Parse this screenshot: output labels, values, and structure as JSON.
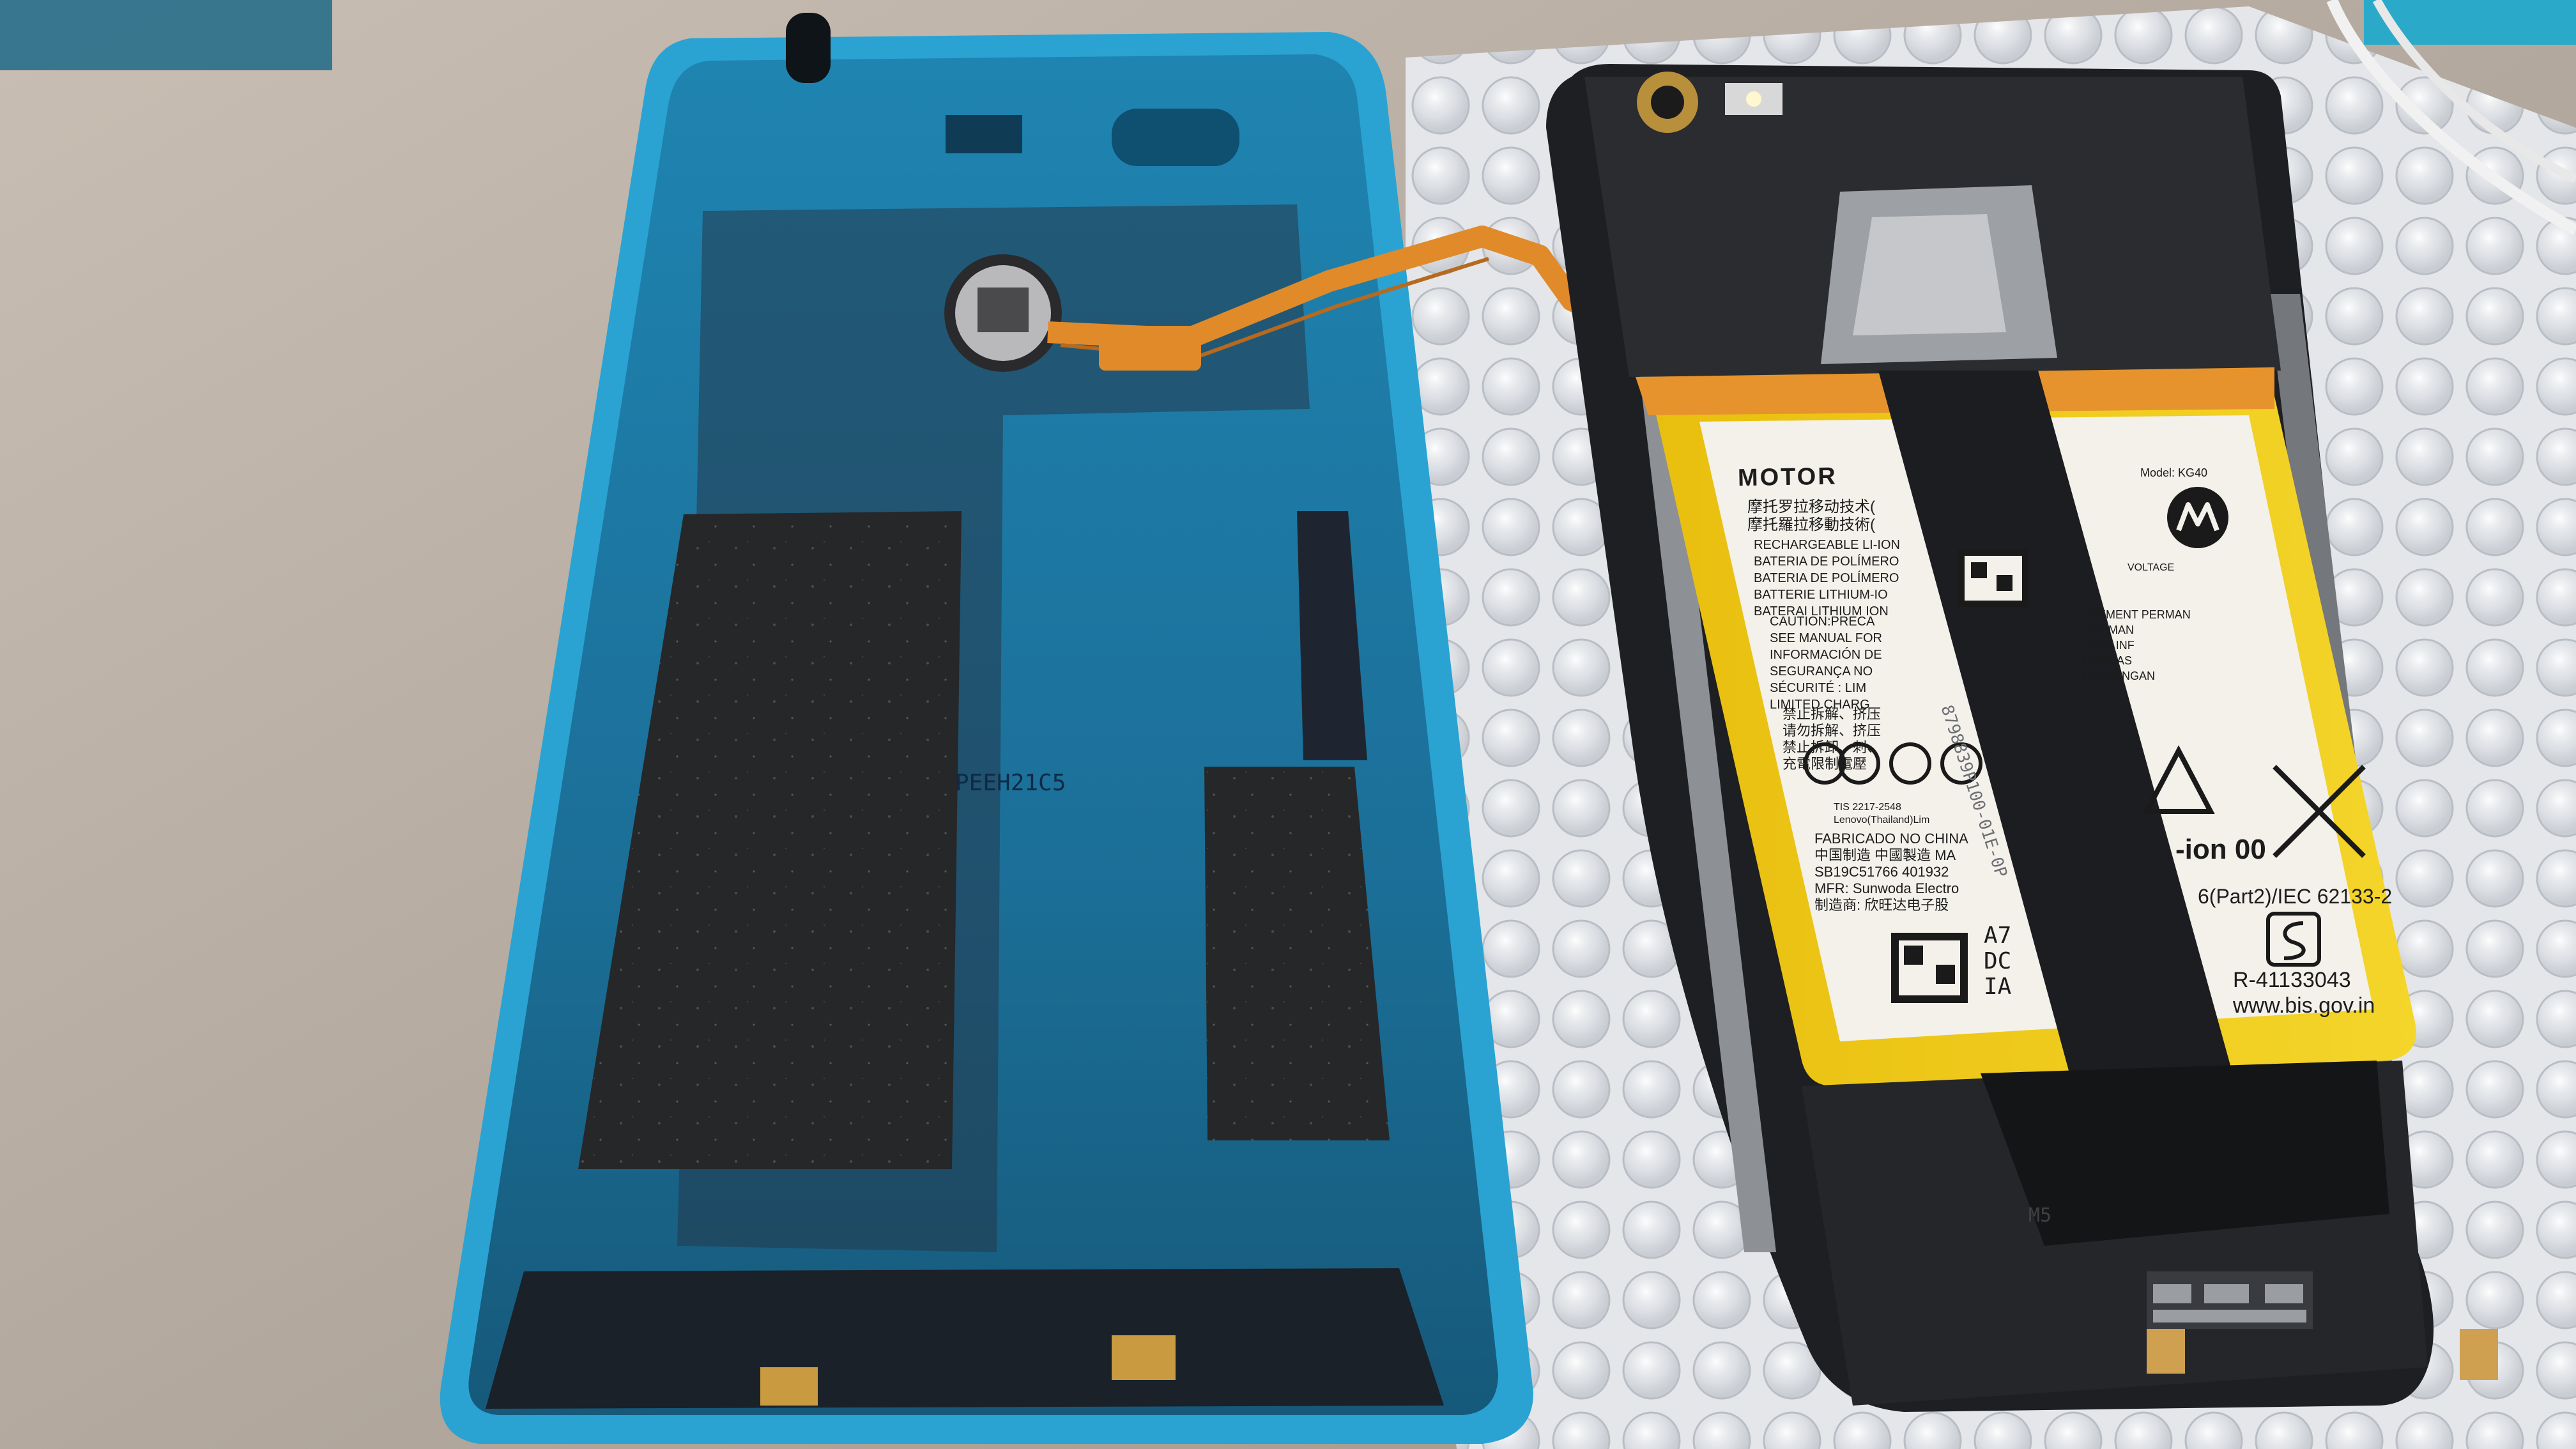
{
  "photo": {
    "subject": "Disassembled smartphone with back cover removed",
    "colors": {
      "table": "#b7ada3",
      "bubble_wrap": "#e6e8ec",
      "back_cover": "#1d7aa6",
      "cover_edge": "#2aa3d2",
      "phone_body": "#1e1f22",
      "battery_label": "#f3f1ea",
      "battery_yellow": "#f2c916",
      "flex_cable": "#e6912e"
    }
  },
  "back_cover": {
    "molded_code": "PEEH21C5"
  },
  "battery": {
    "brand": "MOTOR",
    "model_text": "Model: KG40",
    "chinese_lines": [
      "摩托罗拉移动技术(",
      "摩托羅拉移動技術("
    ],
    "type_lines": [
      "RECHARGEABLE LI-ION",
      "BATERIA DE POLÍMERO",
      "BATERIA DE POLÍMERO",
      "BATTERIE LITHIUM-IO",
      "BATERAI LITHIUM ION"
    ],
    "caution_lines": [
      "CAUTION:PRECA",
      "SEE MANUAL FOR",
      "INFORMACIÓN DE",
      "SEGURANÇA NO",
      "SÉCURITÉ : LIM",
      "LIMITED CHARG"
    ],
    "right_caution_lines": [
      "SSEMENT PERMAN",
      "VEA MAN",
      "PARA INF",
      "FORMAS",
      "ETEGANGAN"
    ],
    "warning_lines": [
      "禁止拆解、挤压",
      "请勿拆解、挤压",
      "禁止拆卸、刺、",
      "充電限制電壓"
    ],
    "tis_text": "TIS 2217-2548",
    "tis_sub": "Lenovo(Thailand)Lim",
    "fabricado": "FABRICADO NO CHINA",
    "made_in": "中国制造 中國製造  MA",
    "part_number": "SB19C51766  401932",
    "mfr": "MFR: Sunwoda Electro",
    "mfr_cn": "制造商: 欣旺达电子股",
    "ion_text": "-ion 00",
    "iec_text": "6(Part2)/IEC 62133-2",
    "r_number": "R-41133043",
    "website": "www.bis.gov.in",
    "code_a": "A7",
    "code_d": "DC",
    "code_i": "IA",
    "ribbon_code": "8798839P100-01E-0P",
    "voltage_text": "VOLTAGE"
  },
  "phone_frame": {
    "gasket_text": "M5"
  }
}
